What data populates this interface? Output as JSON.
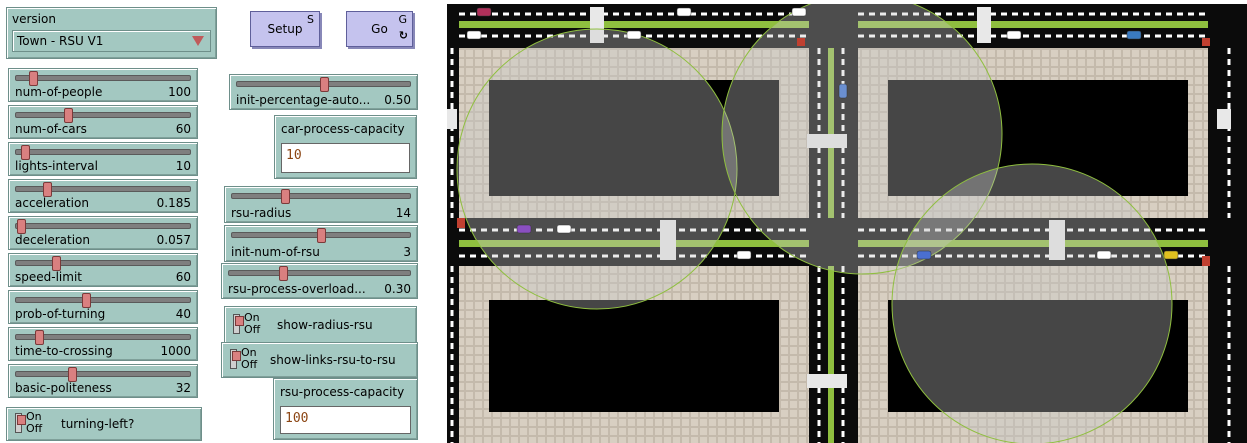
{
  "version": {
    "label": "version",
    "value": "Town - RSU V1"
  },
  "buttons": {
    "setup": {
      "label": "Setup",
      "key": "S"
    },
    "go": {
      "label": "Go",
      "key": "G",
      "icon": "forever-icon"
    }
  },
  "sliders_left": [
    {
      "label": "num-of-people",
      "value": "100",
      "fraction": 0.1
    },
    {
      "label": "num-of-cars",
      "value": "60",
      "fraction": 0.3
    },
    {
      "label": "lights-interval",
      "value": "10",
      "fraction": 0.05
    },
    {
      "label": "acceleration",
      "value": "0.185",
      "fraction": 0.18
    },
    {
      "label": "deceleration",
      "value": "0.057",
      "fraction": 0.03
    },
    {
      "label": "speed-limit",
      "value": "60",
      "fraction": 0.23
    },
    {
      "label": "prob-of-turning",
      "value": "40",
      "fraction": 0.4
    },
    {
      "label": "time-to-crossing",
      "value": "1000",
      "fraction": 0.13
    },
    {
      "label": "basic-politeness",
      "value": "32",
      "fraction": 0.32
    }
  ],
  "sliders_right": [
    {
      "label": "init-percentage-auto...",
      "value": "0.50",
      "fraction": 0.5
    },
    {
      "label": "rsu-radius",
      "value": "14",
      "fraction": 0.3
    },
    {
      "label": "init-num-of-rsu",
      "value": "3",
      "fraction": 0.5
    },
    {
      "label": "rsu-process-overload...",
      "value": "0.30",
      "fraction": 0.3
    }
  ],
  "inputs": {
    "car_capacity": {
      "label": "car-process-capacity",
      "value": "10"
    },
    "rsu_capacity": {
      "label": "rsu-process-capacity",
      "value": "100"
    }
  },
  "switches": {
    "on": "On",
    "off": "Off",
    "show_radius": "show-radius-rsu",
    "show_links": "show-links-rsu-to-rsu",
    "turning_left": "turning-left?"
  },
  "colors": {
    "widget": "#a3c8c1",
    "button": "#c5c3ee",
    "thumb": "#d98080",
    "road": "#0b0b0b",
    "sidewalk": "#d8cfc2",
    "median": "#8fbf3f"
  }
}
